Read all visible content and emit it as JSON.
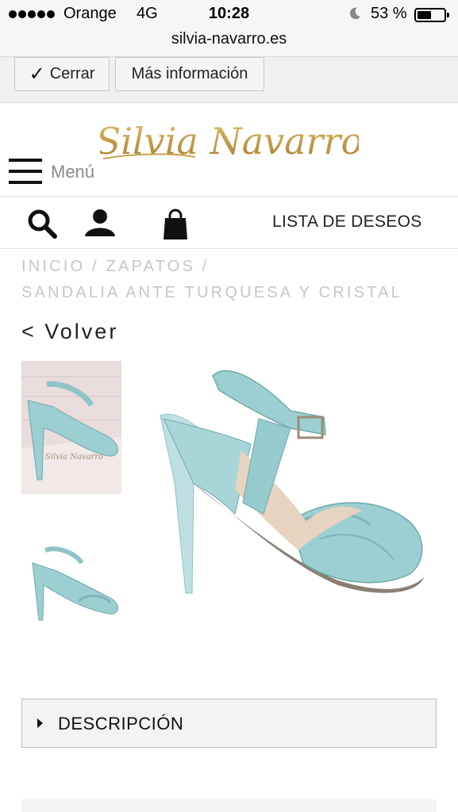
{
  "status_bar": {
    "carrier": "Orange",
    "network": "4G",
    "time": "10:28",
    "battery_percent": "53 %",
    "battery_level": 0.53,
    "icons": [
      "signal-dots-icon",
      "moon-icon",
      "battery-icon"
    ]
  },
  "browser": {
    "url": "silvia-navarro.es"
  },
  "cookie_bar": {
    "close_label": "Cerrar",
    "more_info_label": "Más información",
    "check_glyph": "✓"
  },
  "header": {
    "logo_text": "Silvia Navarro",
    "menu_label": "Menú",
    "logo_color": "#c9a14a"
  },
  "icon_bar": {
    "icons": [
      "search-icon",
      "user-icon",
      "shopping-bag-icon"
    ],
    "wishlist_label": "LISTA DE DESEOS"
  },
  "breadcrumb": {
    "line1": "INICIO  /  ZAPATOS  /",
    "line2": "SANDALIA ANTE TURQUESA Y CRISTAL"
  },
  "back_label": "<  Volver",
  "product": {
    "accent_color": "#9ccfd1",
    "thumbnails": 2
  },
  "description": {
    "label": "DESCRIPCIÓN"
  }
}
